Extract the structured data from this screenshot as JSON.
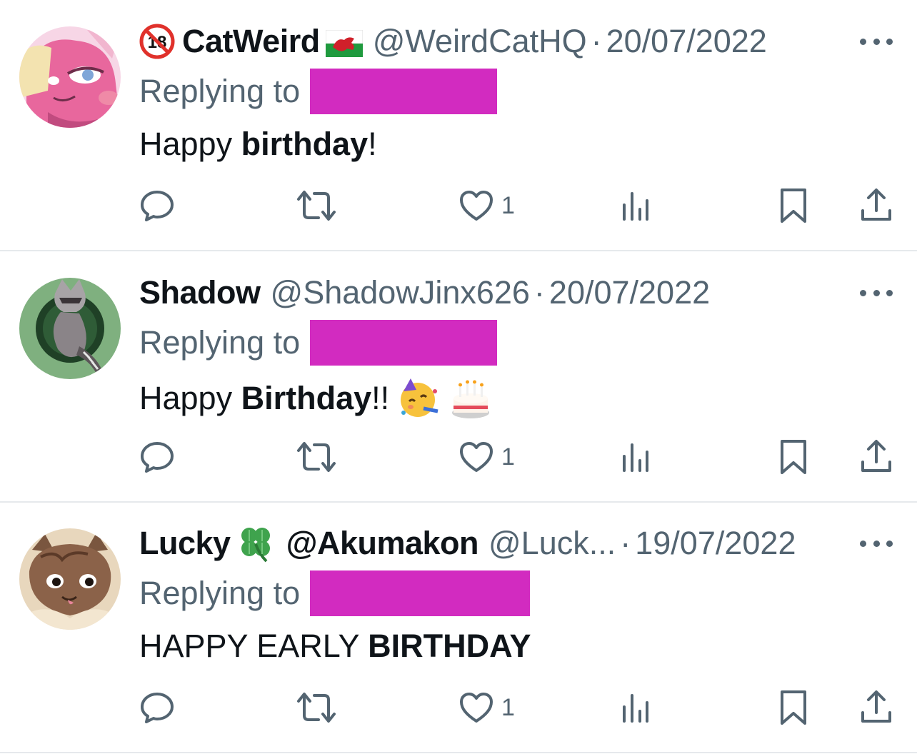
{
  "tweets": [
    {
      "name": "CatWeird",
      "handle": "@WeirdCatHQ",
      "separator": "·",
      "date": "20/07/2022",
      "reply_prefix": "Replying to",
      "body_plain": "Happy ",
      "body_bold": "birthday",
      "body_tail": "!",
      "like_count": "1",
      "icons": [
        "18-plus-badge-icon",
        "wales-flag-icon"
      ]
    },
    {
      "name": "Shadow",
      "handle": "@ShadowJinx626",
      "separator": "·",
      "date": "20/07/2022",
      "reply_prefix": "Replying to",
      "body_plain": "Happy ",
      "body_bold": "Birthday",
      "body_tail": "!!",
      "like_count": "1",
      "icons": [
        "partying-face-emoji",
        "birthday-cake-emoji"
      ]
    },
    {
      "name": "Lucky",
      "name_suffix": "@Akumakon",
      "handle": "@Luck...",
      "separator": "·",
      "date": "19/07/2022",
      "reply_prefix": "Replying to",
      "body_plain": "HAPPY EARLY ",
      "body_bold": "BIRTHDAY",
      "body_tail": "",
      "like_count": "1",
      "icons": [
        "four-leaf-clover-emoji"
      ]
    }
  ],
  "colors": {
    "text_primary": "#0f1419",
    "text_secondary": "#536471",
    "redaction": "#d22bc0",
    "divider": "#e6e9ec"
  }
}
